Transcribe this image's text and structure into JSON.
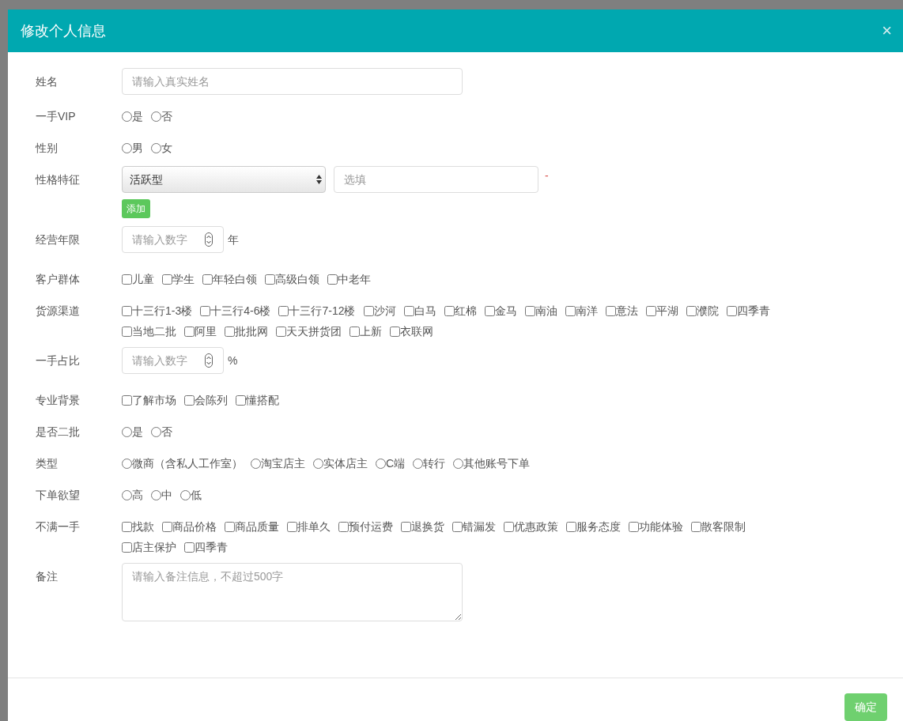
{
  "modal": {
    "title": "修改个人信息",
    "close": "×"
  },
  "fields": [
    {
      "kind": "text",
      "label": "姓名",
      "placeholder": "请输入真实姓名"
    },
    {
      "kind": "radio",
      "label": "一手VIP",
      "options": [
        {
          "label": "是",
          "selected": false
        },
        {
          "label": "否",
          "selected": false
        }
      ]
    },
    {
      "kind": "radio",
      "label": "性别",
      "options": [
        {
          "label": "男",
          "selected": false
        },
        {
          "label": "女",
          "selected": false
        }
      ]
    },
    {
      "kind": "select",
      "label": "性格特征",
      "value": "活跃型",
      "placeholder": "选填",
      "remove": "-",
      "add": "添加"
    },
    {
      "kind": "number",
      "label": "经营年限",
      "placeholder": "请输入数字",
      "unit": "年"
    },
    {
      "kind": "checkbox",
      "label": "客户群体",
      "options": [
        {
          "label": "儿童",
          "checked": false
        },
        {
          "label": "学生",
          "checked": false
        },
        {
          "label": "年轻白领",
          "checked": false
        },
        {
          "label": "高级白领",
          "checked": false
        },
        {
          "label": "中老年",
          "checked": false
        }
      ]
    },
    {
      "kind": "checkbox",
      "label": "货源渠道",
      "options": [
        {
          "label": "十三行1-3楼",
          "checked": false
        },
        {
          "label": "十三行4-6楼",
          "checked": false
        },
        {
          "label": "十三行7-12楼",
          "checked": false
        },
        {
          "label": "沙河",
          "checked": false
        },
        {
          "label": "白马",
          "checked": false
        },
        {
          "label": "红棉",
          "checked": false
        },
        {
          "label": "金马",
          "checked": false
        },
        {
          "label": "南油",
          "checked": false
        },
        {
          "label": "南洋",
          "checked": false
        },
        {
          "label": "意法",
          "checked": false
        },
        {
          "label": "平湖",
          "checked": false
        },
        {
          "label": "濮院",
          "checked": false
        },
        {
          "label": "四季青",
          "checked": false
        },
        {
          "label": "当地二批",
          "checked": false
        },
        {
          "label": "阿里",
          "checked": false
        },
        {
          "label": "批批网",
          "checked": false
        },
        {
          "label": "天天拼货团",
          "checked": false
        },
        {
          "label": "上新",
          "checked": false
        },
        {
          "label": "衣联网",
          "checked": false
        }
      ]
    },
    {
      "kind": "number",
      "label": "一手占比",
      "placeholder": "请输入数字",
      "unit": "%"
    },
    {
      "kind": "checkbox",
      "label": "专业背景",
      "options": [
        {
          "label": "了解市场",
          "checked": false
        },
        {
          "label": "会陈列",
          "checked": false
        },
        {
          "label": "懂搭配",
          "checked": false
        }
      ]
    },
    {
      "kind": "radio",
      "label": "是否二批",
      "options": [
        {
          "label": "是",
          "selected": false
        },
        {
          "label": "否",
          "selected": false
        }
      ]
    },
    {
      "kind": "radio",
      "label": "类型",
      "options": [
        {
          "label": "微商（含私人工作室）",
          "selected": false
        },
        {
          "label": "淘宝店主",
          "selected": false
        },
        {
          "label": "实体店主",
          "selected": false
        },
        {
          "label": "C端",
          "selected": false
        },
        {
          "label": "转行",
          "selected": false
        },
        {
          "label": "其他账号下单",
          "selected": false
        }
      ]
    },
    {
      "kind": "radio",
      "label": "下单欲望",
      "options": [
        {
          "label": "高",
          "selected": false
        },
        {
          "label": "中",
          "selected": false
        },
        {
          "label": "低",
          "selected": false
        }
      ]
    },
    {
      "kind": "checkbox",
      "label": "不满一手",
      "options": [
        {
          "label": "找款",
          "checked": false
        },
        {
          "label": "商品价格",
          "checked": false
        },
        {
          "label": "商品质量",
          "checked": false
        },
        {
          "label": "排单久",
          "checked": false
        },
        {
          "label": "预付运费",
          "checked": false
        },
        {
          "label": "退换货",
          "checked": false
        },
        {
          "label": "错漏发",
          "checked": false
        },
        {
          "label": "优惠政策",
          "checked": false
        },
        {
          "label": "服务态度",
          "checked": false
        },
        {
          "label": "功能体验",
          "checked": false
        },
        {
          "label": "散客限制",
          "checked": false
        },
        {
          "label": "店主保护",
          "checked": false
        },
        {
          "label": "四季青",
          "checked": false
        }
      ]
    },
    {
      "kind": "textarea",
      "label": "备注",
      "placeholder": "请输入备注信息，不超过500字"
    }
  ],
  "buttons": [
    {
      "label": "确定"
    }
  ]
}
